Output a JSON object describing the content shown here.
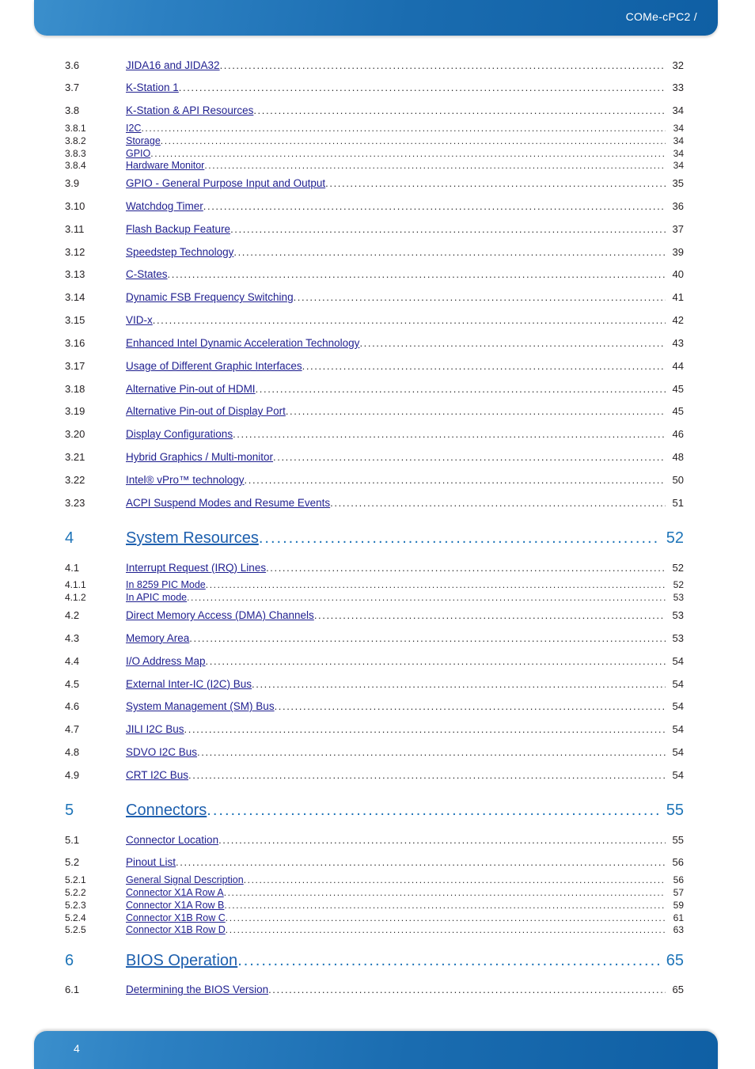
{
  "header": {
    "title": "COMe-cPC2 /"
  },
  "footer": {
    "page_number": "4"
  },
  "colors": {
    "bar_gradient_start": "#3b8fcc",
    "bar_gradient_end": "#0f5fa4",
    "link_blue": "#1f1f8f",
    "chapter_blue": "#1d74b8",
    "text_black": "#231f20"
  },
  "toc": {
    "entries": [
      {
        "level": 2,
        "number": "3.6",
        "title": "JIDA16 and JIDA32",
        "page": "32"
      },
      {
        "level": 2,
        "number": "3.7",
        "title": "K-Station 1",
        "page": "33"
      },
      {
        "level": 2,
        "number": "3.8",
        "title": "K-Station & API Resources",
        "page": "34"
      },
      {
        "level": 3,
        "number": "3.8.1",
        "title": "I2C",
        "page": "34"
      },
      {
        "level": 3,
        "number": "3.8.2",
        "title": "Storage",
        "page": "34"
      },
      {
        "level": 3,
        "number": "3.8.3",
        "title": "GPIO",
        "page": "34"
      },
      {
        "level": 3,
        "number": "3.8.4",
        "title": "Hardware Monitor",
        "page": "34"
      },
      {
        "level": 2,
        "number": "3.9",
        "title": "GPIO - General Purpose Input and Output",
        "page": "35"
      },
      {
        "level": 2,
        "number": "3.10",
        "title": "Watchdog Timer",
        "page": "36"
      },
      {
        "level": 2,
        "number": "3.11",
        "title": "Flash Backup Feature",
        "page": "37"
      },
      {
        "level": 2,
        "number": "3.12",
        "title": "Speedstep Technology",
        "page": "39"
      },
      {
        "level": 2,
        "number": "3.13",
        "title": "C-States",
        "page": "40"
      },
      {
        "level": 2,
        "number": "3.14",
        "title": "Dynamic FSB Frequency Switching",
        "page": "41"
      },
      {
        "level": 2,
        "number": "3.15",
        "title": "VID-x",
        "page": "42"
      },
      {
        "level": 2,
        "number": "3.16",
        "title": "Enhanced Intel Dynamic Acceleration Technology",
        "page": "43"
      },
      {
        "level": 2,
        "number": "3.17",
        "title": "Usage of Different Graphic Interfaces",
        "page": "44"
      },
      {
        "level": 2,
        "number": "3.18",
        "title": "Alternative Pin-out of HDMI",
        "page": "45"
      },
      {
        "level": 2,
        "number": "3.19",
        "title": "Alternative Pin-out of Display Port",
        "page": "45"
      },
      {
        "level": 2,
        "number": "3.20",
        "title": "Display Configurations",
        "page": "46"
      },
      {
        "level": 2,
        "number": "3.21",
        "title": "Hybrid Graphics / Multi-monitor",
        "page": "48"
      },
      {
        "level": 2,
        "number": "3.22",
        "title": "Intel® vPro™ technology",
        "page": "50"
      },
      {
        "level": 2,
        "number": "3.23",
        "title": "ACPI Suspend Modes and Resume Events",
        "page": "51"
      },
      {
        "level": 1,
        "number": "4",
        "title": "System Resources",
        "page": "52"
      },
      {
        "level": 2,
        "number": "4.1",
        "title": "Interrupt Request (IRQ) Lines",
        "page": "52"
      },
      {
        "level": 3,
        "number": "4.1.1",
        "title": "In 8259 PIC Mode",
        "page": "52"
      },
      {
        "level": 3,
        "number": "4.1.2",
        "title": "In APIC mode",
        "page": "53"
      },
      {
        "level": 2,
        "number": "4.2",
        "title": "Direct Memory Access (DMA) Channels",
        "page": "53"
      },
      {
        "level": 2,
        "number": "4.3",
        "title": "Memory Area",
        "page": "53"
      },
      {
        "level": 2,
        "number": "4.4",
        "title": "I/O Address Map",
        "page": "54"
      },
      {
        "level": 2,
        "number": "4.5",
        "title": "External Inter-IC (I2C) Bus",
        "page": "54"
      },
      {
        "level": 2,
        "number": "4.6",
        "title": "System Management (SM) Bus",
        "page": "54"
      },
      {
        "level": 2,
        "number": "4.7",
        "title": "JILI I2C Bus",
        "page": "54"
      },
      {
        "level": 2,
        "number": "4.8",
        "title": "SDVO I2C Bus",
        "page": "54"
      },
      {
        "level": 2,
        "number": "4.9",
        "title": "CRT I2C Bus",
        "page": "54"
      },
      {
        "level": 1,
        "number": "5",
        "title": "Connectors",
        "page": "55"
      },
      {
        "level": 2,
        "number": "5.1",
        "title": "Connector Location",
        "page": "55"
      },
      {
        "level": 2,
        "number": "5.2",
        "title": "Pinout List",
        "page": "56"
      },
      {
        "level": 3,
        "number": "5.2.1",
        "title": "General Signal Description",
        "page": "56"
      },
      {
        "level": 3,
        "number": "5.2.2",
        "title": "Connector X1A Row A",
        "page": "57"
      },
      {
        "level": 3,
        "number": "5.2.3",
        "title": "Connector X1A Row B",
        "page": "59"
      },
      {
        "level": 3,
        "number": "5.2.4",
        "title": "Connector X1B Row C",
        "page": "61"
      },
      {
        "level": 3,
        "number": "5.2.5",
        "title": "Connector X1B Row D",
        "page": "63"
      },
      {
        "level": 1,
        "number": "6",
        "title": "BIOS Operation",
        "page": "65"
      },
      {
        "level": 2,
        "number": "6.1",
        "title": "Determining the BIOS Version",
        "page": "65"
      }
    ]
  }
}
